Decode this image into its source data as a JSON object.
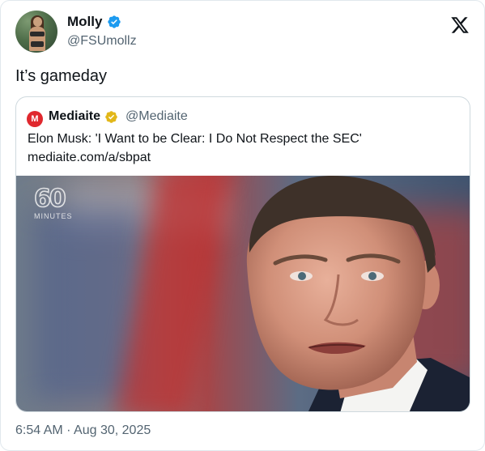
{
  "author": {
    "display_name": "Molly",
    "handle": "@FSUmollz",
    "verified": true,
    "verified_color": "#1d9bf0"
  },
  "tweet": {
    "text": "It’s gameday",
    "timestamp": "6:54 AM · Aug 30, 2025"
  },
  "quote": {
    "display_name": "Mediaite",
    "handle": "@Mediaite",
    "logo_letter": "M",
    "logo_color": "#e0282e",
    "verified_color": "#e2b719",
    "text": "Elon Musk: 'I Want to be Clear: I Do Not Respect the SEC'",
    "link": "mediaite.com/a/sbpat",
    "image": {
      "logo_number": "60",
      "logo_caption": "MINUTES"
    }
  },
  "icons": {
    "platform": "x-logo-icon",
    "author_badge": "verified-badge-icon",
    "quote_badge": "gold-verified-badge-icon"
  }
}
